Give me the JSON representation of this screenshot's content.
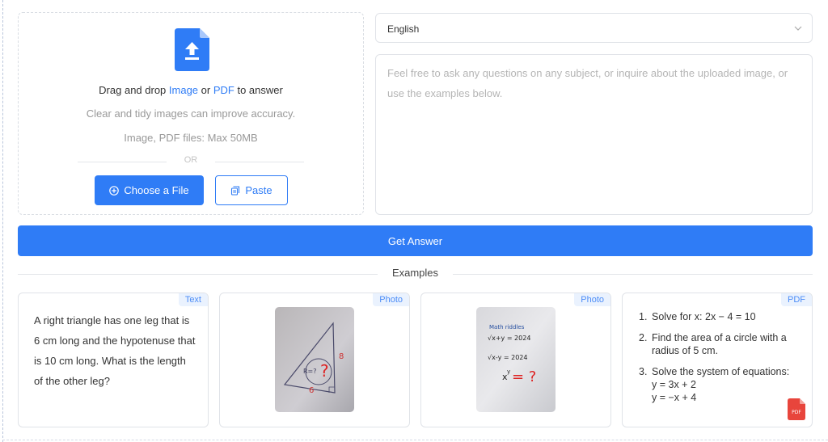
{
  "upload": {
    "drag_prefix": "Drag and drop ",
    "drag_image": "Image",
    "drag_or": " or ",
    "drag_pdf": "PDF",
    "drag_suffix": " to answer",
    "tidy": "Clear and tidy images can improve accuracy.",
    "limits": "Image, PDF files: Max 50MB",
    "or": "OR",
    "choose_label": "Choose a File",
    "paste_label": "Paste"
  },
  "language": {
    "selected": "English"
  },
  "question": {
    "placeholder": "Feel free to ask any questions on any subject, or inquire about the uploaded image, or use the examples below.",
    "value": ""
  },
  "get_answer_label": "Get Answer",
  "examples": {
    "title": "Examples",
    "cards": [
      {
        "tag": "Text",
        "text": "A right triangle has one leg that is 6 cm long and the hypotenuse that is 10 cm long. What is the length of the other leg?"
      },
      {
        "tag": "Photo",
        "photo": {
          "inner": "R=?",
          "right": "8",
          "bottom": "6"
        }
      },
      {
        "tag": "Photo",
        "photo": {
          "title": "Math riddles",
          "line1": "√x+y = 2024",
          "line2": "√x-y = 2024",
          "line3": "x",
          "line3_exp": "y",
          "line3_q": "= ?"
        }
      },
      {
        "tag": "PDF",
        "items": [
          {
            "num": "1.",
            "lines": [
              "Solve for x: 2x − 4 = 10"
            ]
          },
          {
            "num": "2.",
            "lines": [
              "Find the area of a circle with a",
              "radius of 5 cm."
            ]
          },
          {
            "num": "3.",
            "lines": [
              "Solve the system of equations:",
              "y = 3x + 2",
              "y = −x + 4"
            ]
          }
        ],
        "badge": "PDF"
      }
    ]
  },
  "colors": {
    "accent": "#2f7cf6",
    "tag_bg": "#eaf2fe",
    "pdf_red": "#e8453c"
  }
}
